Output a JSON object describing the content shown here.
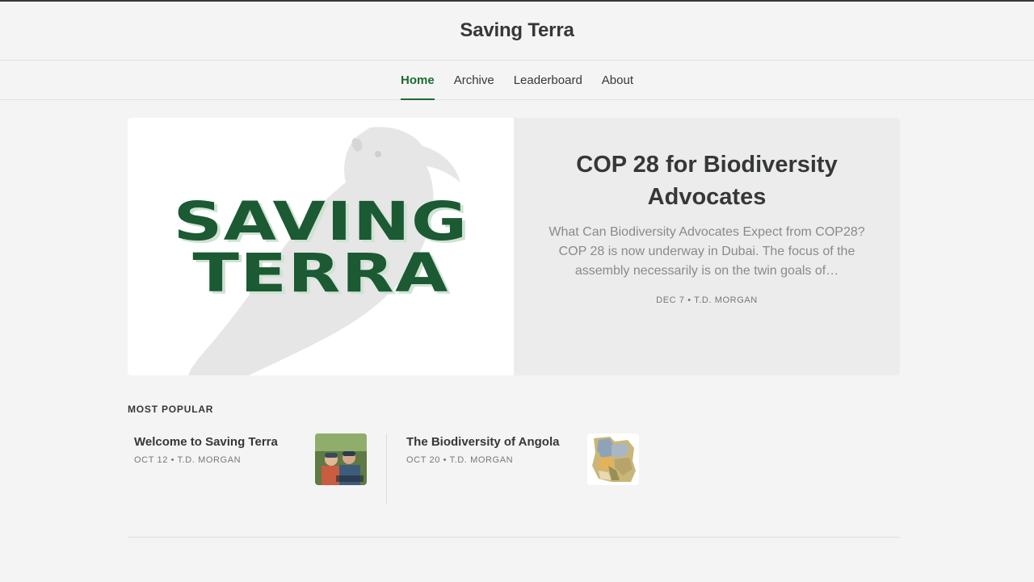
{
  "site": {
    "title": "Saving Terra"
  },
  "nav": {
    "items": [
      {
        "label": "Home",
        "active": true
      },
      {
        "label": "Archive",
        "active": false
      },
      {
        "label": "Leaderboard",
        "active": false
      },
      {
        "label": "About",
        "active": false
      }
    ]
  },
  "hero": {
    "logo_line_1": "SAVING",
    "logo_line_2": "TERRA",
    "title": "COP 28 for Biodiversity Advocates",
    "subtitle": "What Can Biodiversity Advocates Expect from COP28? COP 28 is now underway in Dubai. The focus of the assembly necessarily is on the twin goals of…",
    "meta": "DEC 7 • T.D. MORGAN"
  },
  "popular": {
    "label": "MOST POPULAR",
    "items": [
      {
        "title": "Welcome to Saving Terra",
        "meta": "OCT 12 • T.D. MORGAN",
        "thumb": "people-photo"
      },
      {
        "title": "The Biodiversity of Angola",
        "meta": "OCT 20 • T.D. MORGAN",
        "thumb": "angola-map"
      }
    ]
  },
  "colors": {
    "accent": "#1d6b2d",
    "logo_green": "#1b5a33",
    "background": "#f4f4f4",
    "text": "#363737"
  }
}
